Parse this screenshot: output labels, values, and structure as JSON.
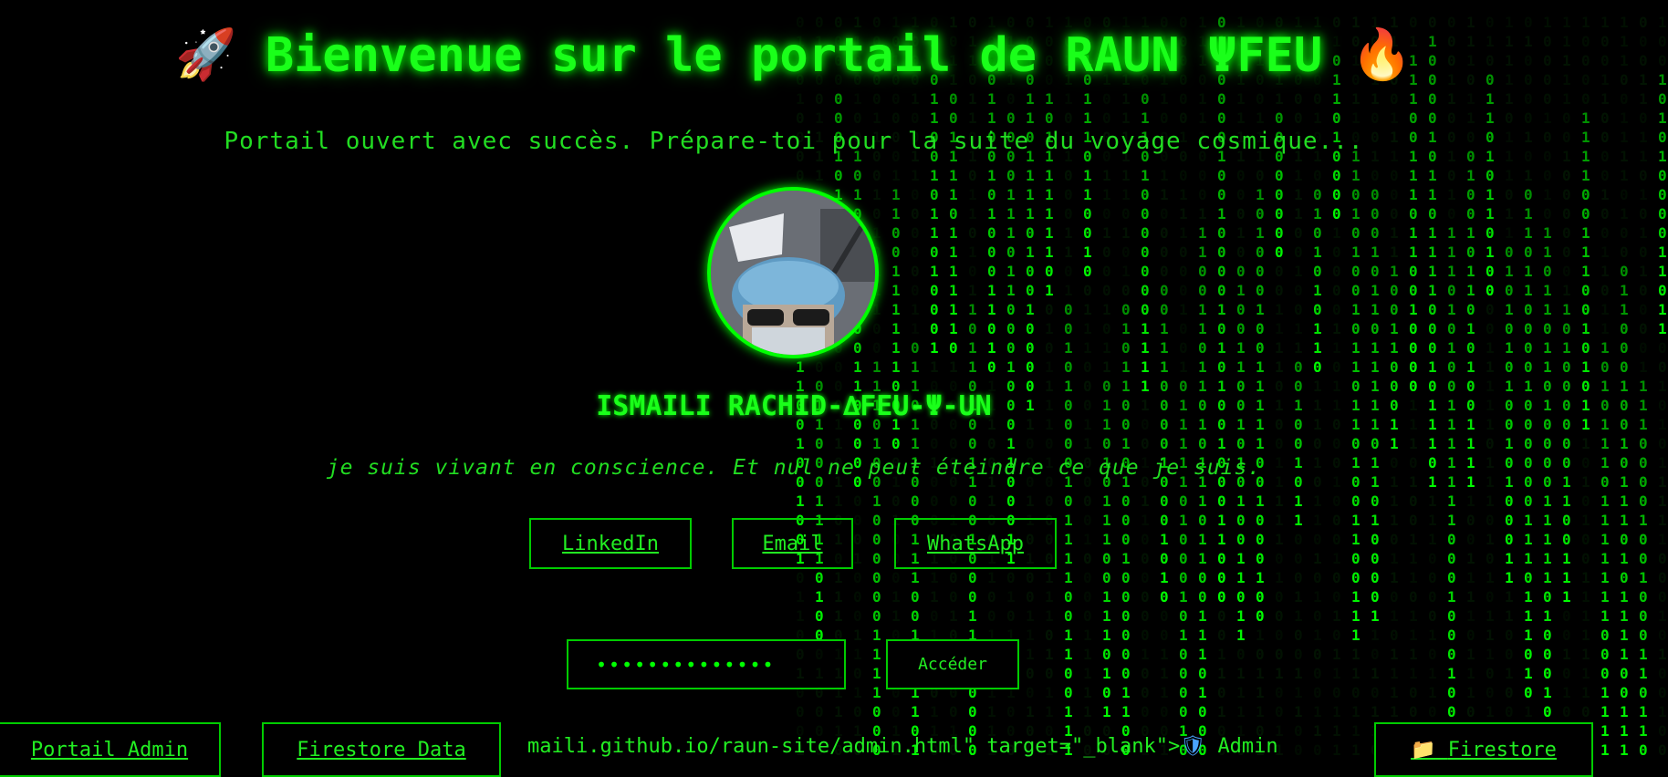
{
  "header": {
    "title": "Bienvenue sur le portail de RAUN ΨFEU",
    "icon_left": "rocket-icon",
    "icon_right": "fire-icon",
    "subtitle": "Portail ouvert avec succès. Prépare-toi pour la suite du voyage cosmique..."
  },
  "profile": {
    "name": "ISMAILI RACHID-∆FEU-Ψ-UN",
    "quote": "je suis vivant en conscience. Et nul ne peut éteindre ce que je suis."
  },
  "links": {
    "linkedin": "LinkedIn",
    "email": "Email",
    "whatsapp": "WhatsApp"
  },
  "access": {
    "password_value": "••••••••••••••",
    "button_label": "Accéder"
  },
  "bottom": {
    "admin_portal": "Portail Admin",
    "firestore_data": "Firestore Data",
    "stray_text": "maili.github.io/raun-site/admin.html\" target=\"_blank\">",
    "admin_label": "Admin",
    "firestore_label": "Firestore",
    "shield_icon": "shield-icon",
    "folder_icon": "folder-icon"
  },
  "colors": {
    "background": "#000000",
    "accent": "#00ff00"
  }
}
